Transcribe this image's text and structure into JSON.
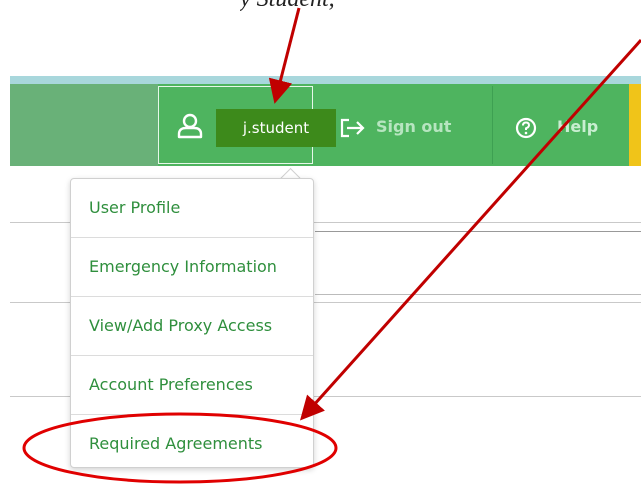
{
  "caption": "y Student,",
  "header": {
    "username": "j.student",
    "signout_label": "Sign out",
    "help_label": "Help"
  },
  "dropdown": {
    "items": [
      {
        "label": "User Profile"
      },
      {
        "label": "Emergency Information"
      },
      {
        "label": "View/Add Proxy Access"
      },
      {
        "label": "Account Preferences"
      },
      {
        "label": "Required Agreements"
      }
    ]
  },
  "annotations": {
    "arrow_color": "#c00000",
    "highlight_color": "#e00000"
  },
  "colors": {
    "header_green": "#4eb45f",
    "header_left_green": "#69b178",
    "username_bg": "#3d8a1b",
    "menu_text": "#2f8f3d",
    "accent_yellow": "#f0c419"
  },
  "icons": {
    "user": "user-icon",
    "signout": "sign-out-icon",
    "help": "help-circle-icon"
  }
}
